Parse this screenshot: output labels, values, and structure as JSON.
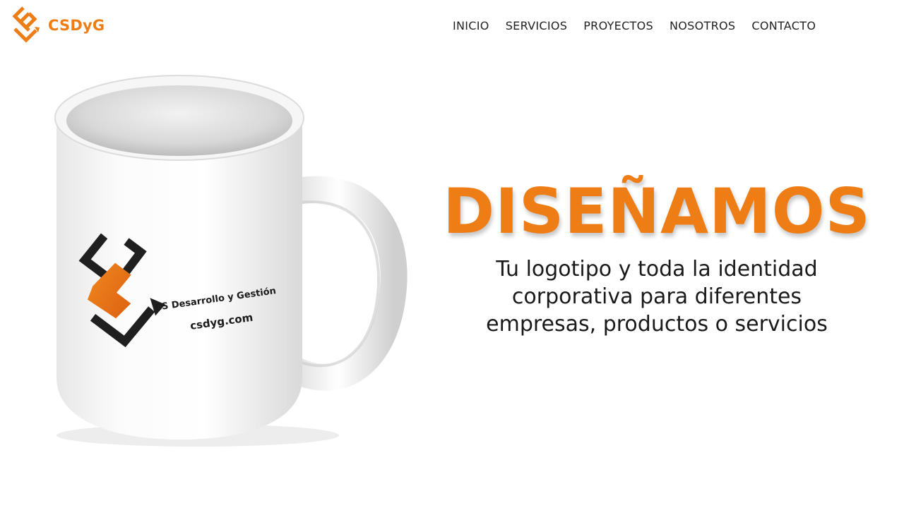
{
  "header": {
    "brand_name": "CSDyG",
    "brand_logo_icon": "csdyg-logo-icon",
    "nav": [
      {
        "label": "INICIO"
      },
      {
        "label": "SERVICIOS"
      },
      {
        "label": "PROYECTOS"
      },
      {
        "label": "NOSOTROS"
      },
      {
        "label": "CONTACTO"
      }
    ]
  },
  "mug": {
    "print_company": "CS Desarrollo y Gestión",
    "print_url": "csdyg.com"
  },
  "hero": {
    "title": "DISEÑAMOS",
    "subtitle": "Tu logotipo y toda la identidad corporativa para diferentes empresas, productos o servicios"
  },
  "colors": {
    "brand_orange": "#ee7d16",
    "text_dark": "#1a1a1a",
    "background": "#ffffff"
  }
}
